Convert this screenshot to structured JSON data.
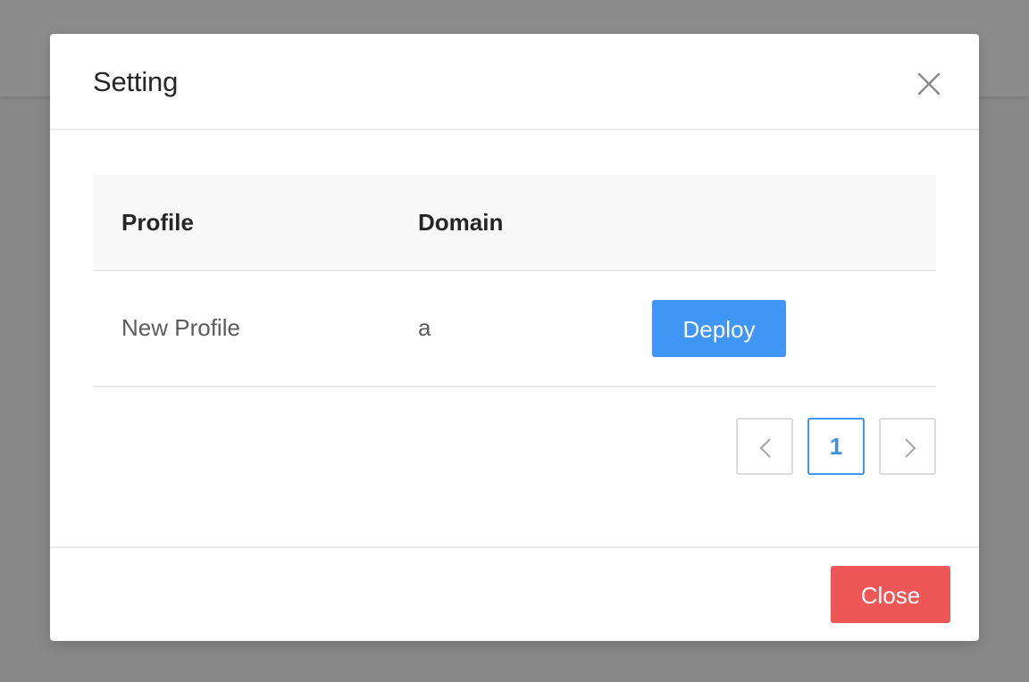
{
  "dialog": {
    "title": "Setting",
    "close_icon": "close-icon"
  },
  "table": {
    "columns": [
      "Profile",
      "Domain",
      ""
    ],
    "rows": [
      {
        "profile": "New Profile",
        "domain": "a",
        "action_label": "Deploy"
      }
    ]
  },
  "pagination": {
    "prev_icon": "chevron-left-icon",
    "current_page": "1",
    "next_icon": "chevron-right-icon"
  },
  "footer": {
    "close_label": "Close"
  },
  "colors": {
    "primary": "#4096f5",
    "danger": "#ef5757",
    "overlay": "#888888"
  }
}
